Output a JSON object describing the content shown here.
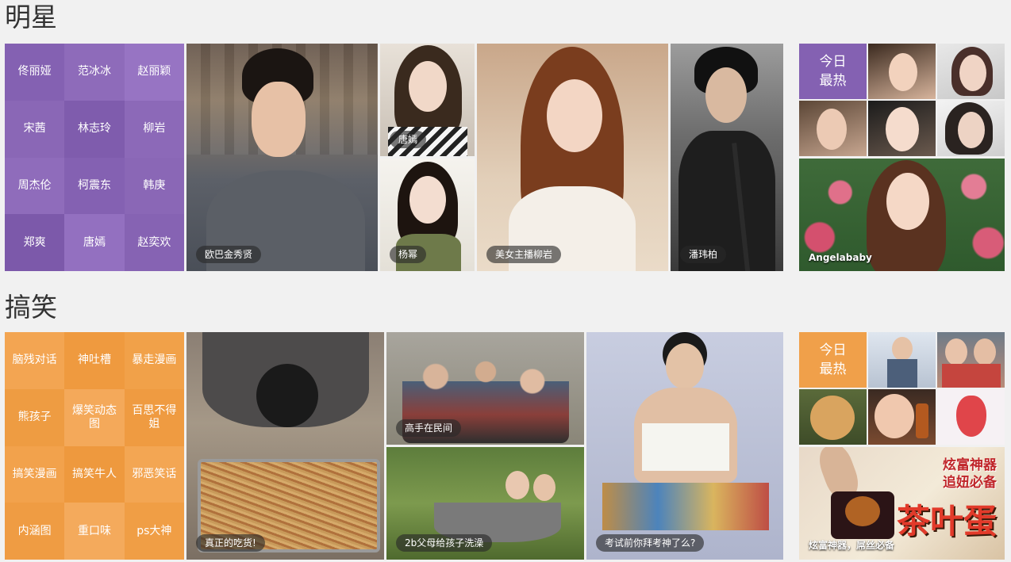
{
  "stars": {
    "title": "明星",
    "grid": [
      {
        "label": "佟丽娅",
        "color": "#8461b2"
      },
      {
        "label": "范冰冰",
        "color": "#8e6bba"
      },
      {
        "label": "赵丽颖",
        "color": "#9774c3"
      },
      {
        "label": "宋茜",
        "color": "#8a67b6"
      },
      {
        "label": "林志玲",
        "color": "#7f5cad"
      },
      {
        "label": "柳岩",
        "color": "#8c69b8"
      },
      {
        "label": "周杰伦",
        "color": "#8f6cbb"
      },
      {
        "label": "柯震东",
        "color": "#8461b2"
      },
      {
        "label": "韩庚",
        "color": "#8a67b6"
      },
      {
        "label": "郑爽",
        "color": "#7c59aa"
      },
      {
        "label": "唐嫣",
        "color": "#9370c0"
      },
      {
        "label": "赵奕欢",
        "color": "#8663b3"
      }
    ],
    "tiles": [
      {
        "caption": "欧巴金秀贤"
      },
      {
        "caption": "唐嫣"
      },
      {
        "caption": "杨幂"
      },
      {
        "caption": "美女主播柳岩"
      },
      {
        "caption": "潘玮柏"
      }
    ],
    "hot": {
      "line1": "今日",
      "line2": "最热",
      "color": "#8461b2"
    },
    "hot_tile": {
      "caption": "Angelababy"
    }
  },
  "funny": {
    "title": "搞笑",
    "grid": [
      {
        "label": "脑残对话",
        "color": "#f3a552"
      },
      {
        "label": "神吐槽",
        "color": "#ef9a3f"
      },
      {
        "label": "暴走漫画",
        "color": "#f1a149"
      },
      {
        "label": "熊孩子",
        "color": "#ee9c42"
      },
      {
        "label": "爆笑动态图",
        "color": "#f4a95a"
      },
      {
        "label": "百思不得姐",
        "color": "#ef9b41"
      },
      {
        "label": "搞笑漫画",
        "color": "#f2a24c"
      },
      {
        "label": "搞笑牛人",
        "color": "#ee993e"
      },
      {
        "label": "邪恶笑话",
        "color": "#f3a653"
      },
      {
        "label": "内涵图",
        "color": "#ef9c43"
      },
      {
        "label": "重口味",
        "color": "#f4aa5c"
      },
      {
        "label": "ps大神",
        "color": "#f09e45"
      }
    ],
    "tiles": [
      {
        "caption": "真正的吃货!"
      },
      {
        "caption": "高手在民间"
      },
      {
        "caption": "2b父母给孩子洗澡"
      },
      {
        "caption": "考试前你拜考神了么?"
      }
    ],
    "hot": {
      "line1": "今日",
      "line2": "最热",
      "color": "#f0a04a"
    },
    "hot_tile": {
      "caption": "炫富神器，屌丝必备"
    },
    "promo": {
      "line1": "炫富神器",
      "line2": "追妞必备",
      "big": "茶叶蛋"
    }
  }
}
